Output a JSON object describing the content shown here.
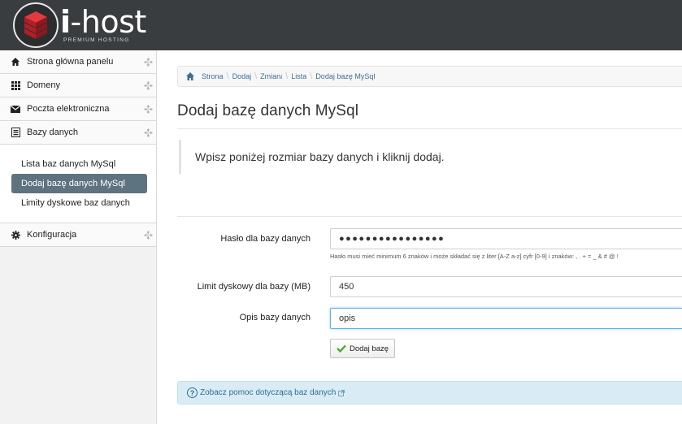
{
  "header": {
    "logo_title": "i-host",
    "logo_title_i": "i",
    "logo_title_rest": "-host",
    "logo_subtitle": "PREMIUM HOSTING"
  },
  "sidebar": {
    "items": [
      {
        "label": "Strona główna panelu",
        "icon": "home-icon"
      },
      {
        "label": "Domeny",
        "icon": "grid-icon"
      },
      {
        "label": "Poczta elektroniczna",
        "icon": "envelope-icon"
      },
      {
        "label": "Bazy danych",
        "icon": "list-icon"
      }
    ],
    "submenu": [
      {
        "label": "Lista baz danych MySql"
      },
      {
        "label": "Dodaj bazę danych MySql"
      },
      {
        "label": "Limity dyskowe baz danych"
      }
    ],
    "config": {
      "label": "Konfiguracja",
      "icon": "gear-icon"
    }
  },
  "breadcrumb": {
    "items": [
      "Strona",
      "Dodaj",
      "Zmiana",
      "Lista"
    ],
    "current": "Dodaj bazę MySql"
  },
  "page": {
    "title": "Dodaj bazę danych MySql",
    "info": "Wpisz poniżej rozmiar bazy danych i kliknij dodaj."
  },
  "form": {
    "password_label": "Hasło dla bazy danych",
    "password_value": "●●●●●●●●●●●●●●●●",
    "password_help": "Hasło musi mieć minimum 6 znaków i może składać się z liter [A-Z a-z] cyfr [0-9] i znaków: , . + = _ & # @ !",
    "limit_label": "Limit dyskowy dla bazy (MB)",
    "limit_value": "450",
    "desc_label": "Opis bazy danych",
    "desc_value": "opis",
    "submit_label": "Dodaj bazę"
  },
  "helpbar": {
    "label": "Zobacz pomoc dotyczącą baz danych"
  },
  "colors": {
    "header_bg": "#3a3d3f",
    "active_item_bg": "#5e7380",
    "link": "#3a6f98",
    "logo_red": "#c8232c",
    "check_green": "#4caf32"
  }
}
